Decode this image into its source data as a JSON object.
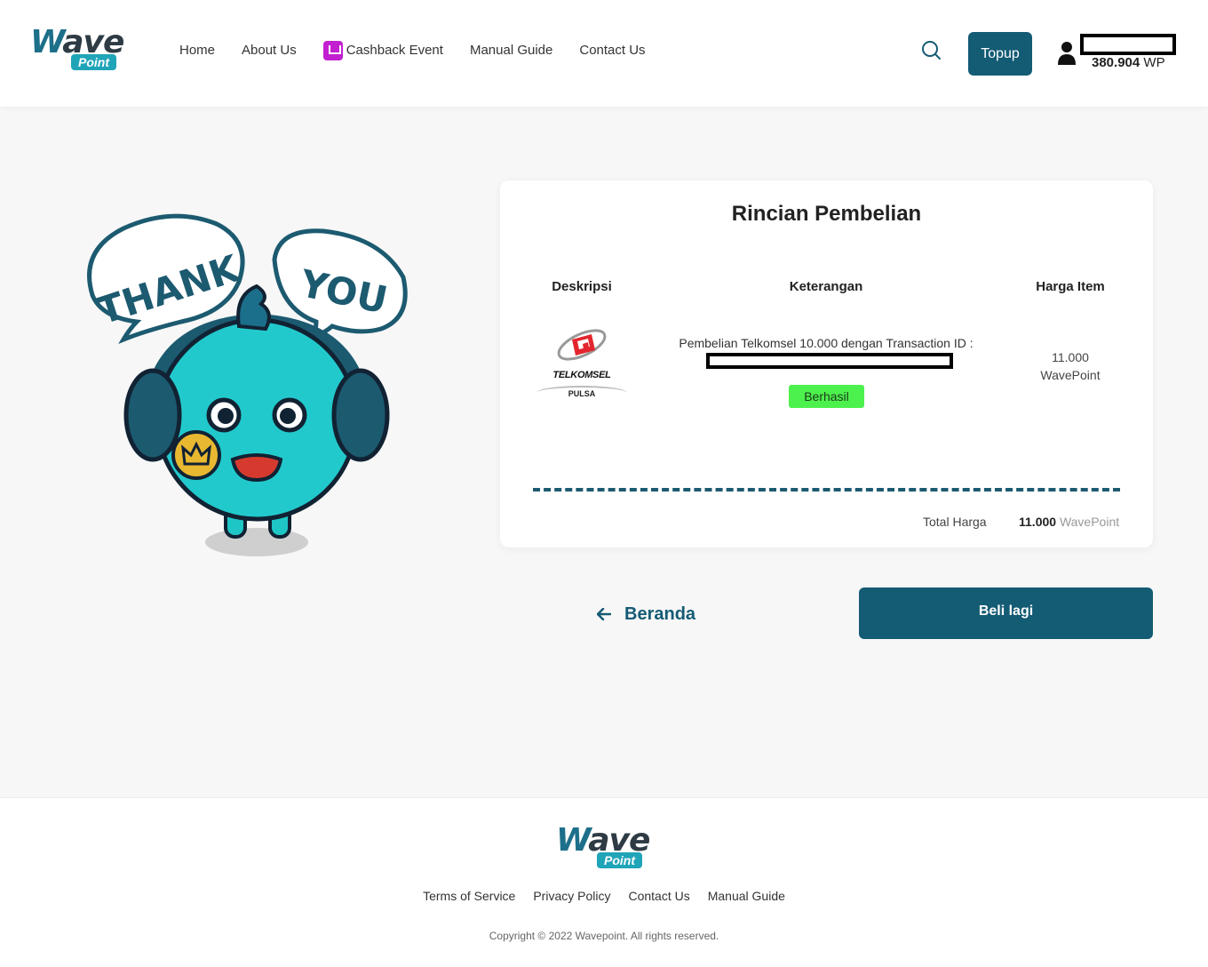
{
  "brand": {
    "word": "ave",
    "initial": "W",
    "pill": "Point"
  },
  "nav": {
    "home": "Home",
    "about": "About Us",
    "cashback": "Cashback Event",
    "manual": "Manual Guide",
    "contact": "Contact Us"
  },
  "header": {
    "topup_label": "Topup",
    "balance_value": "380.904",
    "balance_unit": "WP"
  },
  "illustration": {
    "speech_left": "THANK",
    "speech_right": "YOU"
  },
  "purchase": {
    "title": "Rincian Pembelian",
    "columns": {
      "desc": "Deskripsi",
      "info": "Keterangan",
      "price": "Harga Item"
    },
    "item": {
      "brand": "TELKOMSEL",
      "type": "PULSA",
      "description": "Pembelian Telkomsel 10.000 dengan Transaction ID :",
      "status": "Berhasil",
      "price_value": "11.000",
      "price_unit": "WavePoint"
    },
    "total_label": "Total Harga",
    "total_value": "11.000",
    "total_unit": "WavePoint"
  },
  "actions": {
    "back_label": "Beranda",
    "buy_again_label": "Beli lagi"
  },
  "footer": {
    "links": {
      "terms": "Terms of Service",
      "privacy": "Privacy Policy",
      "contact": "Contact Us",
      "manual": "Manual Guide"
    },
    "copyright": "Copyright © 2022 Wavepoint. All rights reserved."
  },
  "colors": {
    "primary": "#145b74",
    "accent": "#1fa4b8",
    "success": "#4df14d"
  }
}
